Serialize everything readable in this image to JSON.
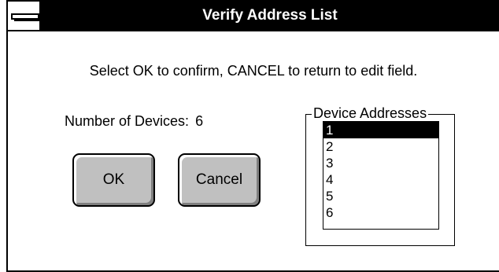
{
  "window": {
    "title": "Verify Address List"
  },
  "instruction": "Select OK to confirm, CANCEL to return to edit field.",
  "devices": {
    "count_label": "Number of Devices:",
    "count": "6"
  },
  "buttons": {
    "ok": "OK",
    "cancel": "Cancel"
  },
  "address_group": {
    "label": "Device Addresses",
    "items": [
      "1",
      "2",
      "3",
      "4",
      "5",
      "6"
    ],
    "selected_index": 0
  }
}
